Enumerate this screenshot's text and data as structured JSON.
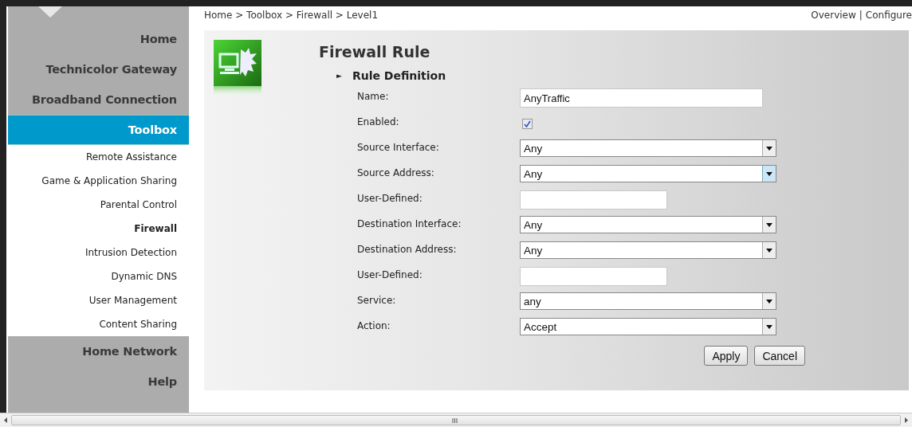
{
  "sidebar": {
    "items": [
      {
        "label": "Home",
        "kind": "main",
        "selected": false
      },
      {
        "label": "Technicolor Gateway",
        "kind": "main",
        "selected": false
      },
      {
        "label": "Broadband Connection",
        "kind": "main",
        "selected": false
      },
      {
        "label": "Toolbox",
        "kind": "main",
        "selected": true
      },
      {
        "label": "Remote Assistance",
        "kind": "sub",
        "selected": false
      },
      {
        "label": "Game & Application Sharing",
        "kind": "sub",
        "selected": false
      },
      {
        "label": "Parental Control",
        "kind": "sub",
        "selected": false
      },
      {
        "label": "Firewall",
        "kind": "sub",
        "selected": true
      },
      {
        "label": "Intrusion Detection",
        "kind": "sub",
        "selected": false
      },
      {
        "label": "Dynamic DNS",
        "kind": "sub",
        "selected": false
      },
      {
        "label": "User Management",
        "kind": "sub",
        "selected": false
      },
      {
        "label": "Content Sharing",
        "kind": "sub",
        "selected": false
      },
      {
        "label": "Home Network",
        "kind": "main",
        "selected": false
      },
      {
        "label": "Help",
        "kind": "main",
        "selected": false
      }
    ]
  },
  "breadcrumb": "Home > Toolbox > Firewall > Level1",
  "header_links": {
    "items": [
      "Overview",
      "Configure"
    ],
    "separator": "|"
  },
  "panel": {
    "title": "Firewall Rule",
    "section": {
      "marker": "►",
      "title": "Rule Definition"
    },
    "fields": [
      {
        "label": "Name:",
        "kind": "text",
        "wide": true,
        "value": "AnyTraffic"
      },
      {
        "label": "Enabled:",
        "kind": "checkbox",
        "checked": true
      },
      {
        "label": "Source Interface:",
        "kind": "select",
        "value": "Any",
        "hovered": false
      },
      {
        "label": "Source Address:",
        "kind": "select",
        "value": "Any",
        "hovered": true
      },
      {
        "label": "User-Defined:",
        "kind": "text",
        "wide": false
      },
      {
        "label": "Destination Interface:",
        "kind": "select",
        "value": "Any",
        "hovered": false
      },
      {
        "label": "Destination Address:",
        "kind": "select",
        "value": "Any",
        "hovered": false
      },
      {
        "label": "User-Defined:",
        "kind": "text",
        "wide": false
      },
      {
        "label": "Service:",
        "kind": "select",
        "value": "any",
        "hovered": false
      },
      {
        "label": "Action:",
        "kind": "select",
        "value": "Accept",
        "hovered": false
      }
    ],
    "buttons": [
      "Apply",
      "Cancel"
    ]
  }
}
